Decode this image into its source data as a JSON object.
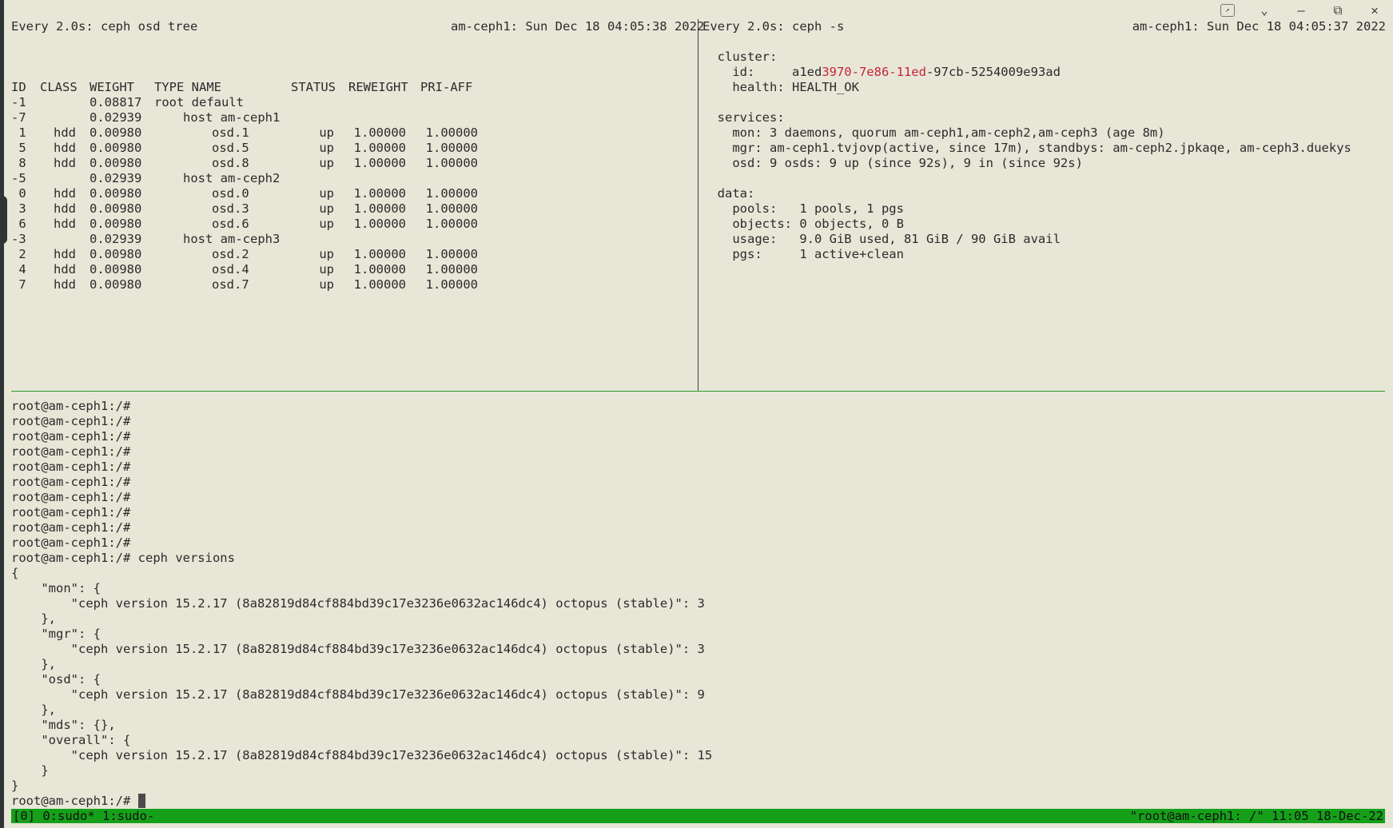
{
  "window_controls": {
    "pin_icon": "pin-icon",
    "dropdown_icon": "chevron-down-icon",
    "minimize_icon": "minimize-icon",
    "restore_icon": "restore-icon",
    "close_icon": "close-icon"
  },
  "left_pane": {
    "header_left": "Every 2.0s: ceph osd tree",
    "header_right": "am-ceph1: Sun Dec 18 04:05:38 2022",
    "columns": [
      "ID",
      "CLASS",
      "WEIGHT",
      "TYPE NAME",
      "STATUS",
      "REWEIGHT",
      "PRI-AFF"
    ],
    "rows": [
      {
        "id": "-1",
        "class": "",
        "weight": "0.08817",
        "name": "root default",
        "indent": 0,
        "status": "",
        "reweight": "",
        "priaff": ""
      },
      {
        "id": "-7",
        "class": "",
        "weight": "0.02939",
        "name": "host am-ceph1",
        "indent": 1,
        "status": "",
        "reweight": "",
        "priaff": ""
      },
      {
        "id": " 1",
        "class": "hdd",
        "weight": "0.00980",
        "name": "osd.1",
        "indent": 2,
        "status": "up",
        "reweight": "1.00000",
        "priaff": "1.00000"
      },
      {
        "id": " 5",
        "class": "hdd",
        "weight": "0.00980",
        "name": "osd.5",
        "indent": 2,
        "status": "up",
        "reweight": "1.00000",
        "priaff": "1.00000"
      },
      {
        "id": " 8",
        "class": "hdd",
        "weight": "0.00980",
        "name": "osd.8",
        "indent": 2,
        "status": "up",
        "reweight": "1.00000",
        "priaff": "1.00000"
      },
      {
        "id": "-5",
        "class": "",
        "weight": "0.02939",
        "name": "host am-ceph2",
        "indent": 1,
        "status": "",
        "reweight": "",
        "priaff": ""
      },
      {
        "id": " 0",
        "class": "hdd",
        "weight": "0.00980",
        "name": "osd.0",
        "indent": 2,
        "status": "up",
        "reweight": "1.00000",
        "priaff": "1.00000"
      },
      {
        "id": " 3",
        "class": "hdd",
        "weight": "0.00980",
        "name": "osd.3",
        "indent": 2,
        "status": "up",
        "reweight": "1.00000",
        "priaff": "1.00000"
      },
      {
        "id": " 6",
        "class": "hdd",
        "weight": "0.00980",
        "name": "osd.6",
        "indent": 2,
        "status": "up",
        "reweight": "1.00000",
        "priaff": "1.00000"
      },
      {
        "id": "-3",
        "class": "",
        "weight": "0.02939",
        "name": "host am-ceph3",
        "indent": 1,
        "status": "",
        "reweight": "",
        "priaff": ""
      },
      {
        "id": " 2",
        "class": "hdd",
        "weight": "0.00980",
        "name": "osd.2",
        "indent": 2,
        "status": "up",
        "reweight": "1.00000",
        "priaff": "1.00000"
      },
      {
        "id": " 4",
        "class": "hdd",
        "weight": "0.00980",
        "name": "osd.4",
        "indent": 2,
        "status": "up",
        "reweight": "1.00000",
        "priaff": "1.00000"
      },
      {
        "id": " 7",
        "class": "hdd",
        "weight": "0.00980",
        "name": "osd.7",
        "indent": 2,
        "status": "up",
        "reweight": "1.00000",
        "priaff": "1.00000"
      }
    ]
  },
  "right_pane": {
    "header_left": "Every 2.0s: ceph -s",
    "header_right": "am-ceph1: Sun Dec 18 04:05:37 2022",
    "cluster_label": "  cluster:",
    "id_prefix": "    id:     a1ed",
    "id_highlight": "3970-7e86-11ed",
    "id_suffix": "-97cb-5254009e93ad",
    "health": "    health: HEALTH_OK",
    "services_label": "  services:",
    "mon": "    mon: 3 daemons, quorum am-ceph1,am-ceph2,am-ceph3 (age 8m)",
    "mgr": "    mgr: am-ceph1.tvjovp(active, since 17m), standbys: am-ceph2.jpkaqe, am-ceph3.duekys",
    "osd": "    osd: 9 osds: 9 up (since 92s), 9 in (since 92s)",
    "data_label": "  data:",
    "pools": "    pools:   1 pools, 1 pgs",
    "objects": "    objects: 0 objects, 0 B",
    "usage": "    usage:   9.0 GiB used, 81 GiB / 90 GiB avail",
    "pgs": "    pgs:     1 active+clean"
  },
  "bottom_pane": {
    "prompt": "root@am-ceph1:/#",
    "empty_prompt_count": 10,
    "command": "ceph versions",
    "output": [
      "{",
      "    \"mon\": {",
      "        \"ceph version 15.2.17 (8a82819d84cf884bd39c17e3236e0632ac146dc4) octopus (stable)\": 3",
      "    },",
      "    \"mgr\": {",
      "        \"ceph version 15.2.17 (8a82819d84cf884bd39c17e3236e0632ac146dc4) octopus (stable)\": 3",
      "    },",
      "    \"osd\": {",
      "        \"ceph version 15.2.17 (8a82819d84cf884bd39c17e3236e0632ac146dc4) octopus (stable)\": 9",
      "    },",
      "    \"mds\": {},",
      "    \"overall\": {",
      "        \"ceph version 15.2.17 (8a82819d84cf884bd39c17e3236e0632ac146dc4) octopus (stable)\": 15",
      "    }",
      "}"
    ],
    "final_prompt": "root@am-ceph1:/# "
  },
  "statusbar": {
    "left": "[0] 0:sudo* 1:sudo-",
    "right": "\"root@am-ceph1: /\" 11:05 18-Dec-22",
    "color": "#16a01a"
  },
  "colors": {
    "background": "#e8e6d7",
    "highlight": "#c8243a",
    "separator": "#2e9e2e"
  }
}
